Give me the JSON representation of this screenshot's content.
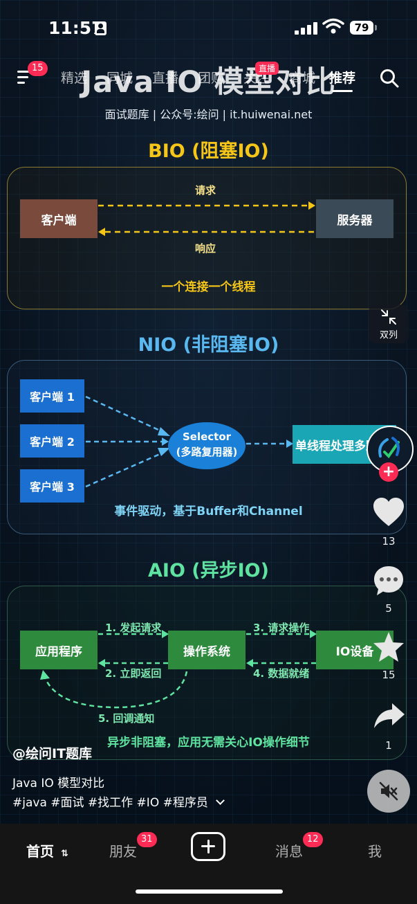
{
  "status_bar": {
    "time": "11:57",
    "battery": "79"
  },
  "top_nav": {
    "menu_badge": "15",
    "tabs": [
      "精选",
      "同城",
      "直播",
      "团购",
      "关注",
      "商城",
      "推荐"
    ],
    "live_badge": "直播"
  },
  "video": {
    "title": "Java IO 模型对比",
    "subtitle": "面试题库 | 公众号:绘问 | it.huiwenai.net",
    "bio": {
      "title": "BIO (阻塞IO)",
      "client": "客户端",
      "server": "服务器",
      "request": "请求",
      "response": "响应",
      "note": "一个连接一个线程"
    },
    "nio": {
      "title": "NIO (非阻塞IO)",
      "clients": [
        "客户端 1",
        "客户端 2",
        "客户端 3"
      ],
      "selector_line1": "Selector",
      "selector_line2": "(多路复用器)",
      "worker": "单线程处理多路",
      "note": "事件驱动，基于Buffer和Channel"
    },
    "aio": {
      "title": "AIO (异步IO)",
      "app": "应用程序",
      "os": "操作系统",
      "io_device": "IO设备",
      "step1": "1. 发起请求",
      "step2": "2. 立即返回",
      "step3": "3. 请求操作",
      "step4": "4. 数据就绪",
      "step5": "5. 回调通知",
      "note": "异步非阻塞，应用无需关心IO操作细节"
    }
  },
  "right_rail": {
    "dual_label": "双列",
    "likes": "13",
    "comments": "5",
    "favorites": "15",
    "shares": "1"
  },
  "caption": {
    "author": "@绘问IT题库",
    "description": "Java IO 模型对比",
    "tags": "#java #面试 #找工作 #IO #程序员"
  },
  "bottom_nav": {
    "home": "首页",
    "friends": "朋友",
    "friends_badge": "31",
    "messages": "消息",
    "messages_badge": "12",
    "me": "我"
  },
  "colors": {
    "accent": "#fe2c55",
    "bio_title": "#f5c518",
    "nio_title": "#5ab8f0",
    "aio_title": "#5ee3a1"
  }
}
